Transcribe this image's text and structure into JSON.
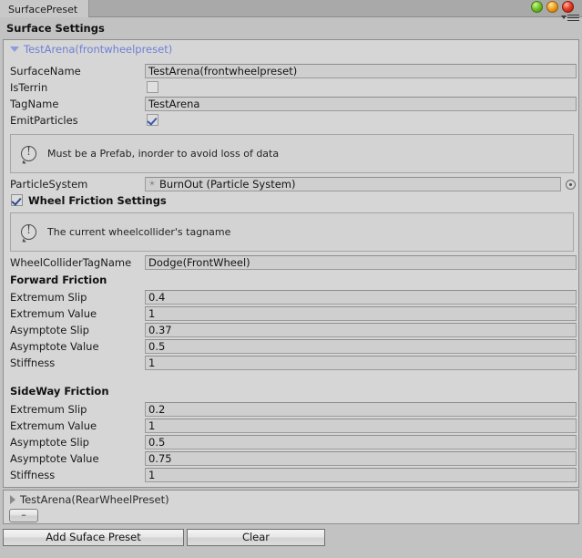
{
  "window": {
    "tab_label": "SurfacePreset",
    "panel_title": "Surface Settings",
    "controls": {
      "green": "#74c72c",
      "orange": "#f0a72a",
      "red": "#e4412a"
    },
    "menu_icon": "menu-dropdown-icon"
  },
  "preset": {
    "foldout_label": "TestArena(frontwheelpreset)",
    "expanded": true,
    "fields": [
      {
        "label": "SurfaceName",
        "type": "text",
        "value": "TestArena(frontwheelpreset)"
      },
      {
        "label": "IsTerrin",
        "type": "checkbox",
        "checked": false
      },
      {
        "label": "TagName",
        "type": "text",
        "value": "TestArena"
      },
      {
        "label": "EmitParticles",
        "type": "checkbox",
        "checked": true
      }
    ],
    "help_prefab": "Must be a Prefab, inorder to avoid loss of data",
    "particle_system": {
      "label": "ParticleSystem",
      "value": "BurnOut (Particle System)",
      "icon": "particle-system-icon",
      "picker_icon": "object-picker-icon"
    },
    "wheel_friction_toggle": {
      "label": "Wheel Friction Settings",
      "checked": true
    },
    "help_tagname": "The current wheelcollider's tagname",
    "wheel_collider_tag": {
      "label": "WheelColliderTagName",
      "value": "Dodge(FrontWheel)"
    },
    "forward_friction": {
      "heading": "Forward Friction",
      "rows": [
        {
          "label": "Extremum Slip",
          "value": "0.4"
        },
        {
          "label": "Extremum Value",
          "value": "1"
        },
        {
          "label": "Asymptote Slip",
          "value": "0.37"
        },
        {
          "label": "Asymptote Value",
          "value": "0.5"
        },
        {
          "label": "Stiffness",
          "value": "1"
        }
      ]
    },
    "sideway_friction": {
      "heading": "SideWay Friction",
      "rows": [
        {
          "label": "Extremum Slip",
          "value": "0.2"
        },
        {
          "label": "Extremum Value",
          "value": "1"
        },
        {
          "label": "Asymptote Slip",
          "value": "0.5"
        },
        {
          "label": "Asymptote Value",
          "value": "0.75"
        },
        {
          "label": "Stiffness",
          "value": "1"
        }
      ]
    }
  },
  "preset2": {
    "foldout_label": "TestArena(RearWheelPreset)",
    "expanded": false,
    "remove_button_label": "–"
  },
  "footer": {
    "add_button_label": "Add Suface Preset",
    "clear_button_label": "Clear"
  }
}
